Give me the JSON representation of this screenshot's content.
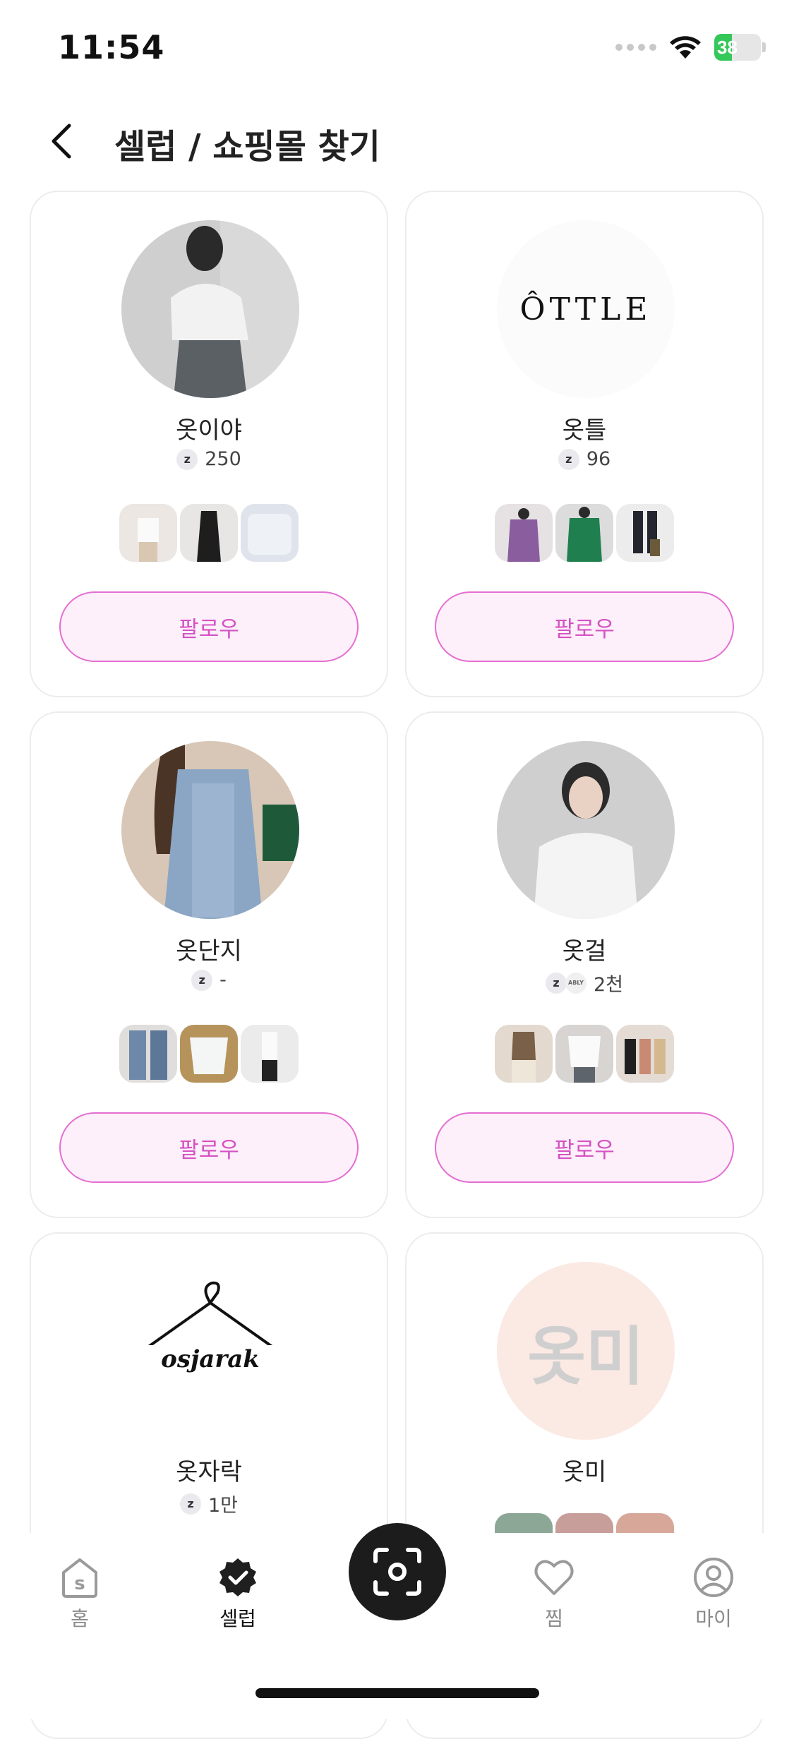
{
  "status_bar": {
    "time": "11:54",
    "battery": "38"
  },
  "header": {
    "title": "셀럽 / 쇼핑몰 찾기"
  },
  "cards": [
    {
      "name": "옷이야",
      "badge": "z",
      "count": "250",
      "follow": "팔로우"
    },
    {
      "name": "옷틀",
      "badge": "z",
      "count": "96",
      "follow": "팔로우",
      "logo_text": "ÔTTLE"
    },
    {
      "name": "옷단지",
      "badge": "z",
      "count": "-",
      "follow": "팔로우"
    },
    {
      "name": "옷걸",
      "badge": "z",
      "badge2": "ABLY",
      "count": "2천",
      "follow": "팔로우"
    },
    {
      "name": "옷자락",
      "badge": "z",
      "count": "1만",
      "logo_text": "osjarak"
    },
    {
      "name": "옷미",
      "logo_text": "옷미"
    }
  ],
  "tabs": [
    {
      "label": "홈",
      "icon": "home-s-icon"
    },
    {
      "label": "셀럽",
      "icon": "verified-badge-icon",
      "active": true
    },
    {
      "label": "",
      "icon": "camera-scan-icon"
    },
    {
      "label": "찜",
      "icon": "heart-icon"
    },
    {
      "label": "마이",
      "icon": "profile-icon"
    }
  ],
  "colors": {
    "accent": "#d552c2",
    "follow_bg": "#fdf0fb",
    "battery": "#34c759"
  }
}
